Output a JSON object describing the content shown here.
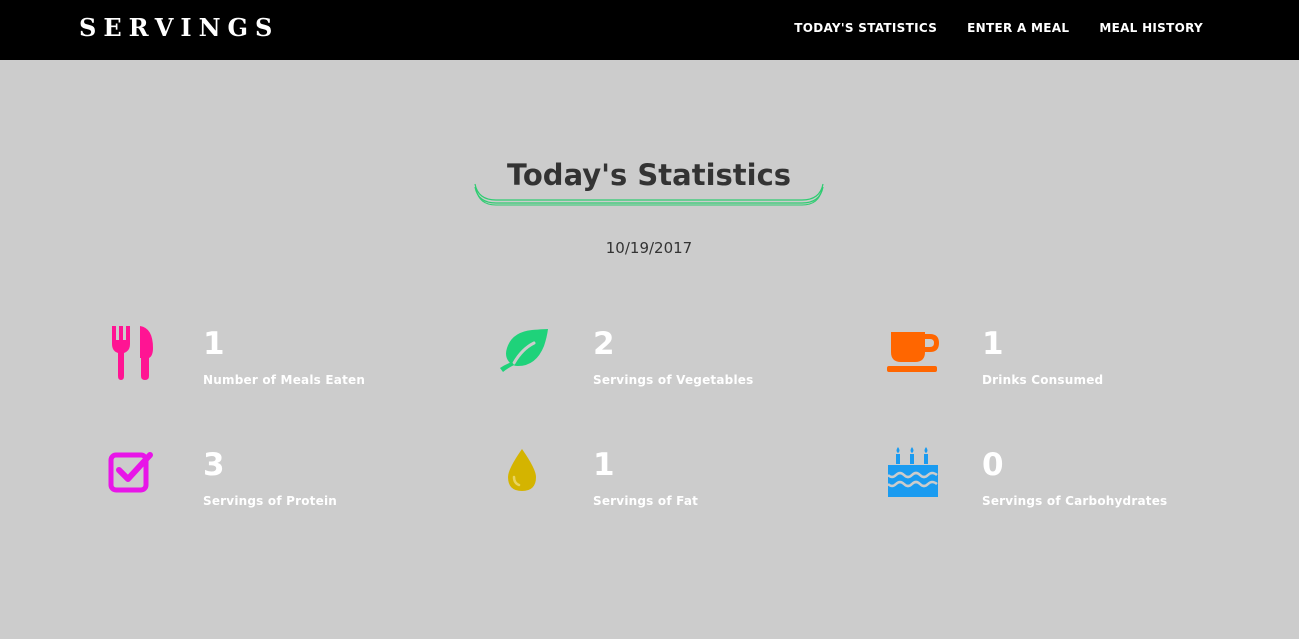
{
  "nav": {
    "brand": "SERVINGS",
    "links": [
      "TODAY'S STATISTICS",
      "ENTER A MEAL",
      "MEAL HISTORY"
    ]
  },
  "page": {
    "title": "Today's Statistics",
    "date": "10/19/2017"
  },
  "colors": {
    "accent": "#2ecc71",
    "background": "#cccccc",
    "navbar": "#000000"
  },
  "stats": [
    {
      "value": "1",
      "label": "Number of Meals Eaten",
      "icon": "fork-knife-icon",
      "color": "#ff1493"
    },
    {
      "value": "2",
      "label": "Servings of Vegetables",
      "icon": "leaf-icon",
      "color": "#1fd27a"
    },
    {
      "value": "1",
      "label": "Drinks Consumed",
      "icon": "coffee-cup-icon",
      "color": "#ff6600"
    },
    {
      "value": "3",
      "label": "Servings of Protein",
      "icon": "checkbox-icon",
      "color": "#e815e8"
    },
    {
      "value": "1",
      "label": "Servings of Fat",
      "icon": "droplet-icon",
      "color": "#d4b400"
    },
    {
      "value": "0",
      "label": "Servings of Carbohydrates",
      "icon": "birthday-cake-icon",
      "color": "#1a9bf0"
    }
  ]
}
